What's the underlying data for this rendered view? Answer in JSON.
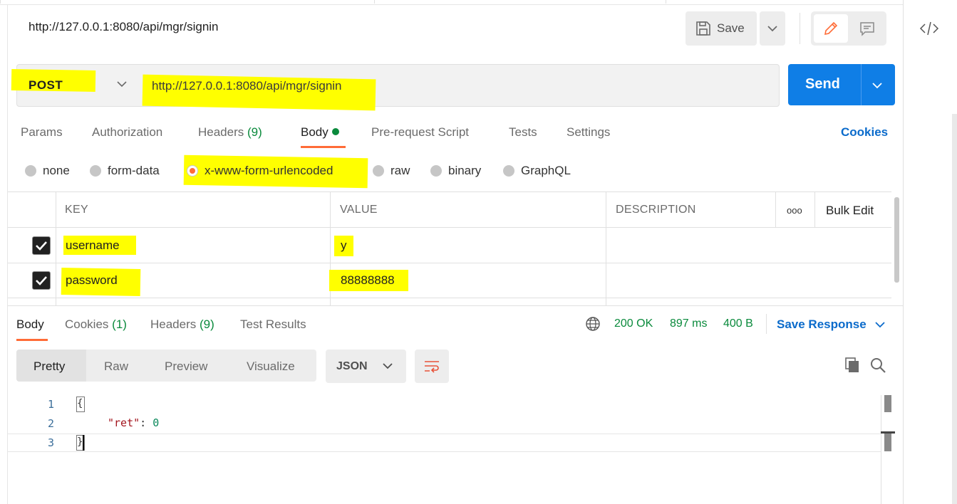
{
  "request": {
    "title": "http://127.0.0.1:8080/api/mgr/signin",
    "save_label": "Save",
    "method": "POST",
    "url": "http://127.0.0.1:8080/api/mgr/signin",
    "send_label": "Send"
  },
  "request_tabs": {
    "params": "Params",
    "authorization": "Authorization",
    "headers": "Headers",
    "headers_count": "(9)",
    "body": "Body",
    "prerequest": "Pre-request Script",
    "tests": "Tests",
    "settings": "Settings",
    "cookies": "Cookies"
  },
  "body_types": {
    "none": "none",
    "form_data": "form-data",
    "urlencoded": "x-www-form-urlencoded",
    "raw": "raw",
    "binary": "binary",
    "graphql": "GraphQL",
    "selected": "x-www-form-urlencoded"
  },
  "params_table": {
    "headers": {
      "key": "KEY",
      "value": "VALUE",
      "description": "DESCRIPTION",
      "more": "ooo",
      "bulk_edit": "Bulk Edit"
    },
    "rows": [
      {
        "checked": true,
        "key": "username",
        "value": "y",
        "description": ""
      },
      {
        "checked": true,
        "key": "password",
        "value": "88888888",
        "description": ""
      }
    ]
  },
  "response": {
    "tabs": {
      "body": "Body",
      "cookies": "Cookies",
      "cookies_count": "(1)",
      "headers": "Headers",
      "headers_count": "(9)",
      "test_results": "Test Results"
    },
    "status": "200 OK",
    "time": "897 ms",
    "size": "400 B",
    "save_response": "Save Response",
    "views": {
      "pretty": "Pretty",
      "raw": "Raw",
      "preview": "Preview",
      "visualize": "Visualize"
    },
    "format": "JSON",
    "code": {
      "line_numbers": [
        "1",
        "2",
        "3"
      ],
      "open_brace": "{",
      "key": "\"ret\"",
      "colon": ": ",
      "value": "0",
      "close_brace": "}"
    }
  },
  "colors": {
    "accent": "#ff6c37",
    "primary": "#0f7ee6",
    "link": "#0b6bcb",
    "success": "#0a8a3c",
    "highlight": "#ffff00"
  },
  "icons": [
    "save-icon",
    "chevron-down-icon",
    "pencil-icon",
    "comment-icon",
    "code-icon",
    "globe-icon",
    "copy-icon",
    "search-icon",
    "wrap-lines-icon"
  ]
}
